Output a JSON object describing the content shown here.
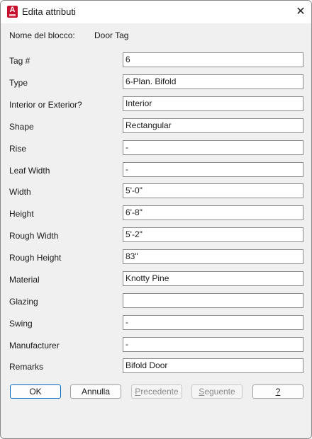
{
  "window": {
    "title": "Edita attributi",
    "app_icon_letter": "A"
  },
  "block": {
    "label": "Nome del blocco:",
    "value": "Door Tag"
  },
  "attributes": [
    {
      "label": "Tag #",
      "value": "6"
    },
    {
      "label": "Type",
      "value": "6-Plan. Bifold"
    },
    {
      "label": "Interior or Exterior?",
      "value": "Interior"
    },
    {
      "label": "Shape",
      "value": "Rectangular"
    },
    {
      "label": "Rise",
      "value": "-"
    },
    {
      "label": "Leaf Width",
      "value": "-"
    },
    {
      "label": "Width",
      "value": "5'-0\""
    },
    {
      "label": "Height",
      "value": "6'-8\""
    },
    {
      "label": "Rough Width",
      "value": "5'-2\""
    },
    {
      "label": "Rough Height",
      "value": "83\""
    },
    {
      "label": "Material",
      "value": "Knotty Pine"
    },
    {
      "label": "Glazing",
      "value": ""
    },
    {
      "label": "Swing",
      "value": "-"
    },
    {
      "label": "Manufacturer",
      "value": "-"
    },
    {
      "label": "Remarks",
      "value": "Bifold Door"
    }
  ],
  "buttons": {
    "ok": "OK",
    "cancel": "Annulla",
    "previous_mnemonic": "P",
    "previous_rest": "recedente",
    "next_mnemonic": "S",
    "next_rest": "eguente",
    "help": "?"
  },
  "colors": {
    "icon_bg": "#c8102e",
    "focus_border": "#0067c0"
  }
}
